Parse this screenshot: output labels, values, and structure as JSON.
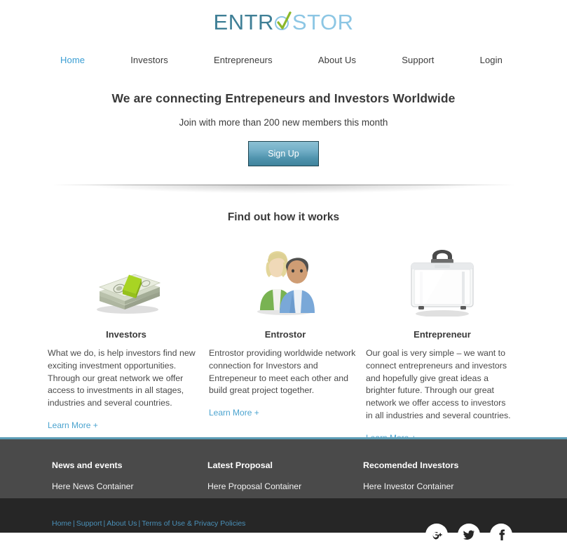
{
  "brand": {
    "logo_part_a": "ENTR",
    "logo_letter_o": "O",
    "logo_part_b": "STOR",
    "logo_full": "ENTROSTOR",
    "color_dark": "#3f7f96",
    "color_light": "#8cc6e4",
    "color_check": "#8cb82b"
  },
  "nav": {
    "items": [
      {
        "label": "Home",
        "active": true
      },
      {
        "label": "Investors",
        "active": false
      },
      {
        "label": "Entrepreneurs",
        "active": false
      },
      {
        "label": "About Us",
        "active": false
      },
      {
        "label": "Support",
        "active": false
      },
      {
        "label": "Login",
        "active": false
      }
    ],
    "active_color": "#3a9ed4"
  },
  "hero": {
    "headline": "We are connecting Entrepeneurs and Investors Worldwide",
    "subline": "Join with more than 200 new members this month",
    "cta_label": "Sign Up",
    "cta_color": "#4f93ad"
  },
  "how": {
    "title": "Find out how it works",
    "columns": [
      {
        "icon": "money-stack-icon",
        "title": "Investors",
        "body": "What we do, is help investors find new exciting investment opportunities. Through our great network we offer access to investments in all stages, industries and several countries.",
        "link_label": "Learn More +"
      },
      {
        "icon": "two-people-icon",
        "title": "Entrostor",
        "body": "Entrostor providing worldwide network connection for Investors and Entrepeneur to meet each other and build great project together.",
        "link_label": "Learn More +"
      },
      {
        "icon": "briefcase-icon",
        "title": "Entrepreneur",
        "body": "Our goal is very simple – we want to connect entrepreneurs and investors and hopefully give great ideas a brighter future. Through our great network we offer access to investors in all industries and several countries.",
        "link_label": "Learn More +"
      }
    ],
    "link_color": "#4ba3cf"
  },
  "footer": {
    "top_border_color": "#5b9cb5",
    "background": "#4a4a4a",
    "columns": [
      {
        "heading": "News and events",
        "content": "Here News Container"
      },
      {
        "heading": "Latest Proposal",
        "content": "Here Proposal Container"
      },
      {
        "heading": "Recomended Investors",
        "content": "Here Investor Container"
      }
    ]
  },
  "bottombar": {
    "background": "#262626",
    "link_color": "#4a90b8",
    "links": [
      {
        "label": "Home"
      },
      {
        "label": "Support"
      },
      {
        "label": "About Us"
      },
      {
        "label": "Terms of Use & Privacy Policies"
      }
    ],
    "separator": "|",
    "socials": [
      {
        "name": "google-plus-icon",
        "glyph": "g+"
      },
      {
        "name": "twitter-icon",
        "glyph": "t"
      },
      {
        "name": "facebook-icon",
        "glyph": "f"
      }
    ]
  }
}
